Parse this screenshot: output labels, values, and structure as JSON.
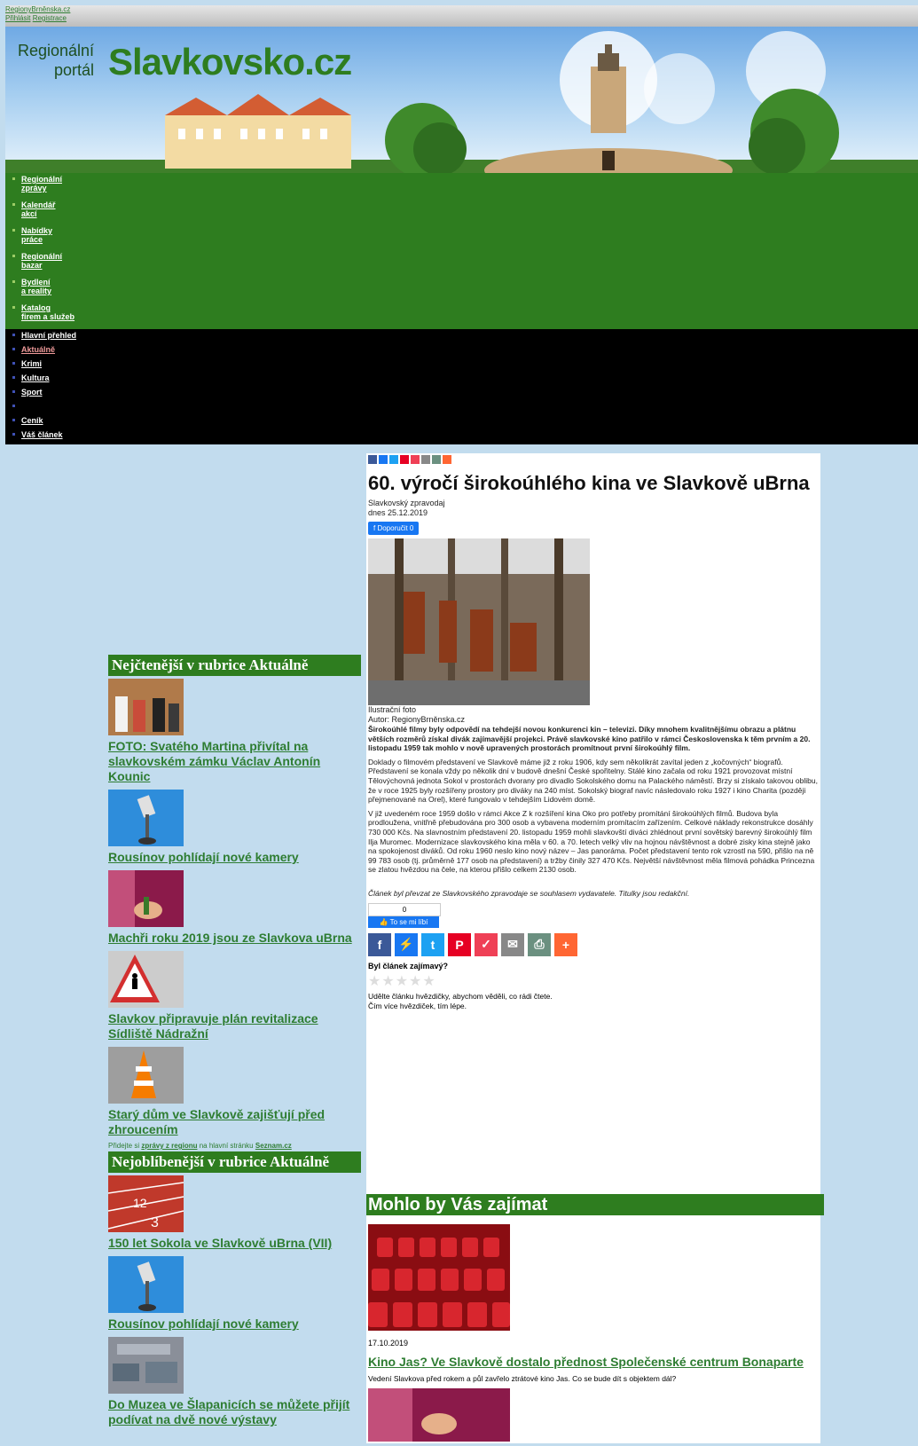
{
  "top_links": {
    "site": "RegionyBrněnska.cz",
    "login": "Přihlásit",
    "register": "Registrace"
  },
  "header": {
    "logo_small_line1": "Regionální",
    "logo_small_line2": "portál",
    "logo_big": "Slavkovsko.cz"
  },
  "green_nav": [
    {
      "line1": "Regionální",
      "line2": "zprávy"
    },
    {
      "line1": "Kalendář",
      "line2": "akcí"
    },
    {
      "line1": "Nabídky",
      "line2": "práce"
    },
    {
      "line1": "Regionální",
      "line2": "bazar"
    },
    {
      "line1": "Bydlení",
      "line2": "a reality"
    },
    {
      "line1": "Katalog",
      "line2": "firem a služeb"
    }
  ],
  "black_nav": [
    {
      "label": "Hlavní přehled"
    },
    {
      "label": "Aktuálně"
    },
    {
      "label": "Krimi"
    },
    {
      "label": "Kultura"
    },
    {
      "label": "Sport"
    },
    {
      "label": ""
    },
    {
      "label": "Ceník"
    },
    {
      "label": "Váš článek"
    }
  ],
  "most_read": {
    "title": "Nejčtenější v rubrice Aktuálně",
    "items": [
      {
        "title": "FOTO: Svatého Martina přivítal na slavkovském zámku Václav Antonín Kounic"
      },
      {
        "title": "Rousínov pohlídají nové kamery"
      },
      {
        "title": "Machři roku 2019 jsou ze Slavkova uBrna"
      },
      {
        "title": "Slavkov připravuje plán revitalizace Sídliště Nádražní"
      },
      {
        "title": "Starý dům ve Slavkově zajišťují před zhroucením"
      }
    ],
    "seznam_pre": "Přidejte si ",
    "seznam_link": "zprávy z regionu",
    "seznam_mid": " na hlavní stránku ",
    "seznam_brand": "Seznam.cz"
  },
  "most_liked": {
    "title": "Nejoblíbenější v rubrice Aktuálně",
    "items": [
      {
        "title": "150 let Sokola ve Slavkově uBrna (VII)"
      },
      {
        "title": "Rousínov pohlídají nové kamery"
      },
      {
        "title": "Do Muzea ve Šlapanicích se můžete přijít podívat na dvě nové výstavy"
      }
    ]
  },
  "article": {
    "title": "60. výročí širokoúhlého kina ve Slavkově uBrna",
    "source": "Slavkovský zpravodaj",
    "date": "dnes 25.12.2019",
    "recommend": "Doporučit 0",
    "photo_caption": "Ilustrační foto",
    "photo_author": "Autor: RegionyBrněnska.cz",
    "p1": "Širokoúhlé filmy byly odpovědí na tehdejší novou konkurenci kin – televizi. Díky mnohem kvalitnějšímu obrazu a plátnu větších rozměrů získal divák zajímavější projekci. Právě slavkovské kino patřilo v rámci Československa k těm prvním a 20. listopadu 1959 tak mohlo v nově upravených prostorách promítnout první širokoúhlý film.",
    "p2": "Doklady o filmovém představení ve Slavkově máme již z roku 1906, kdy sem několikrát zavítal jeden z „kočovných“ biografů. Představení se konala vždy po několik dní v budově dnešní České spořitelny. Stálé kino začala od roku 1921 provozovat místní Tělovýchovná jednota Sokol v prostorách dvorany pro divadlo Sokolského domu na Palackého náměstí. Brzy si získalo takovou oblibu, že v roce 1925 byly rozšířeny prostory pro diváky na 240 míst. Sokolský biograf navíc následovalo roku 1927 i kino Charita (později přejmenované na Orel), které fungovalo v tehdejším Lidovém domě.",
    "p3": "V již uvedeném roce 1959 došlo v rámci Akce Z k rozšíření kina Oko pro potřeby promítání širokoúhlých filmů. Budova byla prodloužena, vnitřně přebudována pro 300 osob a vybavena moderním promítacím zařízením. Celkové náklady rekonstrukce dosáhly 730 000 Kčs. Na slavnostním představení 20. listopadu 1959 mohli slavkovští diváci zhlédnout první sovětský barevný širokoúhlý film Ilja Muromec. Modernizace slavkovského kina měla v 60. a 70. letech velký vliv na hojnou návštěvnost a dobré zisky kina stejně jako na spokojenost diváků. Od roku 1960 neslo kino nový název – Jas panoráma. Počet představení tento rok vzrostl na 590, přišlo na ně 99 783 osob (tj. průměrně 177 osob na představení) a tržby činily 327 470 Kčs. Největší návštěvnost měla filmová pohádka Princezna se zlatou hvězdou na čele, na kterou přišlo celkem 2130 osob.",
    "note": "Článek byl převzat ze Slavkovského zpravodaje se souhlasem vydavatele. Titulky jsou redakční.",
    "like_count": "0",
    "like_label": "To se mi líbí",
    "rating_question": "Byl článek zajímavý?",
    "rating_text1": "Udělte článku hvězdičky, abychom věděli, co rádi čtete.",
    "rating_text2": "Čím více hvězdiček, tím lépe."
  },
  "related": {
    "title": "Mohlo by Vás zajímat",
    "items": [
      {
        "date": "17.10.2019",
        "title": "Kino Jas? Ve Slavkově dostalo přednost Společenské centrum Bonaparte",
        "desc": "Vedení Slavkova před rokem a půl zavřelo ztrátové kino Jas. Co se bude dít s objektem dál?"
      }
    ]
  },
  "colors": {
    "green": "#2e7d1f",
    "black": "#000000",
    "bg": "#c2dcee"
  }
}
